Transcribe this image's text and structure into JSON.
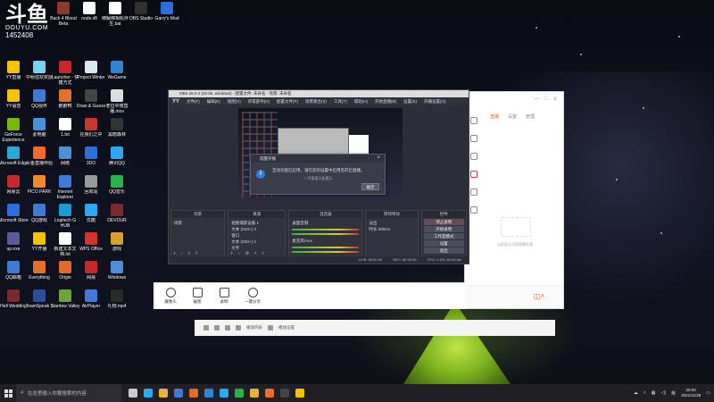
{
  "watermark": {
    "logo": "斗鱼",
    "brand": "DOUYU.COM",
    "room_id": "1452408"
  },
  "desktop_icons": [
    {
      "label": "Back 4 Blood Beta",
      "color": "#8a3a2a"
    },
    {
      "label": "node.dll",
      "color": "#ffffff"
    },
    {
      "label": "绑解绑相机伴生.bat",
      "color": "#ffffff"
    },
    {
      "label": "OBS Studio",
      "color": "#303030"
    },
    {
      "label": "Garry's Mod",
      "color": "#2a6fdb"
    },
    {
      "label": "YY直播",
      "color": "#f3c300"
    },
    {
      "label": "中秋狂欢奖励",
      "color": "#7ad1f0"
    },
    {
      "label": "Launcher - 快捷方式",
      "color": "#c4282b"
    },
    {
      "label": "Project Winter",
      "color": "#d7e6f2"
    },
    {
      "label": "WeGame",
      "color": "#2b86d6"
    },
    {
      "label": "YY语音",
      "color": "#f3c300"
    },
    {
      "label": "QQ视界",
      "color": "#3d7bd6"
    },
    {
      "label": "鹅鹅鸭",
      "color": "#e0722c"
    },
    {
      "label": "Draw & Guess",
      "color": "#444444"
    },
    {
      "label": "老拉中楼直播.mov",
      "color": "#dddddd"
    },
    {
      "label": "GeForce Experience",
      "color": "#76b900"
    },
    {
      "label": "此电脑",
      "color": "#4a90d9"
    },
    {
      "label": "1.txt",
      "color": "#ffffff"
    },
    {
      "label": "在我们之中",
      "color": "#c23a2b"
    },
    {
      "label": "黑暗森林",
      "color": "#333333"
    },
    {
      "label": "Microsoft Edge",
      "color": "#2aa8d6"
    },
    {
      "label": "斗鱼直播伴侣",
      "color": "#ef6a2b"
    },
    {
      "label": "网络",
      "color": "#4a90d9"
    },
    {
      "label": "3DO",
      "color": "#2a6fdb"
    },
    {
      "label": "腾讯QQ",
      "color": "#2aa8f0"
    },
    {
      "label": "网易云",
      "color": "#c4282b"
    },
    {
      "label": "PICO PARK",
      "color": "#ef8a2b"
    },
    {
      "label": "Internet Explorer",
      "color": "#3d7bd6"
    },
    {
      "label": "回收站",
      "color": "#999999"
    },
    {
      "label": "QQ音乐",
      "color": "#27b34a"
    },
    {
      "label": "Microsoft Store",
      "color": "#2a6fdb"
    },
    {
      "label": "QQ游戏",
      "color": "#3d7bd6"
    },
    {
      "label": "Logitech G HUB",
      "color": "#1a9ad6"
    },
    {
      "label": "优酷",
      "color": "#2aa8f0"
    },
    {
      "label": "DEVOUR",
      "color": "#7a2a2a"
    },
    {
      "label": "up.exe",
      "color": "#5a5a9a"
    },
    {
      "label": "YY开播",
      "color": "#f3c300"
    },
    {
      "label": "新建文本文档.txt",
      "color": "#ffffff"
    },
    {
      "label": "WPS Office",
      "color": "#d4332a"
    },
    {
      "label": "游戏",
      "color": "#d6a02a"
    },
    {
      "label": "QQ邮箱",
      "color": "#3d7bd6"
    },
    {
      "label": "Everything",
      "color": "#e0722c"
    },
    {
      "label": "Origin",
      "color": "#e06a2a"
    },
    {
      "label": "网易",
      "color": "#c4282b"
    },
    {
      "label": "Windows",
      "color": "#4a90d9"
    },
    {
      "label": "Hell Wedding",
      "color": "#7a2a2a"
    },
    {
      "label": "TeamSpeak 3",
      "color": "#2a4f9a"
    },
    {
      "label": "Stardew Valley",
      "color": "#6aa63a"
    },
    {
      "label": "AirPlayer",
      "color": "#3d7bd6"
    },
    {
      "label": "礼物.mp4",
      "color": "#2a2a2a"
    }
  ],
  "obs": {
    "title": "OBS 26.0.2 (32-bit, windows) - 配置文件: 未命名 - 场景: 未命名",
    "logo": "YY",
    "menu": [
      "文件(F)",
      "编辑(E)",
      "视图(V)",
      "停靠部件(D)",
      "配置文件(P)",
      "场景集合(S)",
      "工具(T)",
      "帮助(H)",
      "开始直播(B)",
      "设置(S)",
      "开播设置(O)"
    ],
    "dialog": {
      "title": "提醒开播",
      "message": "互动功能已启用，请在您的设置中启用后开启直播。",
      "checkbox": "□ 不再显示此提示",
      "ok": "确定"
    },
    "docks": {
      "scenes": {
        "title": "场景",
        "items": [
          "场景"
        ]
      },
      "sources": {
        "title": "来源",
        "items": [
          "视频捕获设备 1",
          "文本 (GDI+) 3",
          "窗口",
          "文本 (GDI+) 2",
          "文字"
        ]
      },
      "mixer": {
        "title": "混音器",
        "channels": [
          "桌面音频",
          "麦克风/Aux"
        ]
      },
      "transitions": {
        "title": "转场特效",
        "type": "淡出",
        "duration_label": "时长",
        "duration_value": "300ms"
      },
      "controls": {
        "title": "控件",
        "buttons": [
          "停止录制",
          "开始录制",
          "工作室模式",
          "设置",
          "退出"
        ]
      }
    },
    "status": {
      "live": "LIVE: 00:00:00",
      "rec": "REC: 00:00:00",
      "cpu": "CPU: 2.4%, 60.00 fps"
    }
  },
  "stream_client": {
    "buttons": [
      "摄像头",
      "截图",
      "录制",
      "一键分享"
    ],
    "tabs": [
      "直播",
      "设置",
      "管理"
    ],
    "empty_text": "当前暂无可用直播资源"
  },
  "media_bar": {
    "items": [
      "播放列表",
      "播放设置"
    ]
  },
  "taskbar": {
    "search_placeholder": "在这里输入你要搜索的内容",
    "time": "20:03",
    "date": "2021/11/28",
    "ime": "英"
  },
  "colors": {
    "accent": "#e8682b",
    "taskbar": "#1f1f24",
    "obs_bg": "#2b2e38"
  }
}
